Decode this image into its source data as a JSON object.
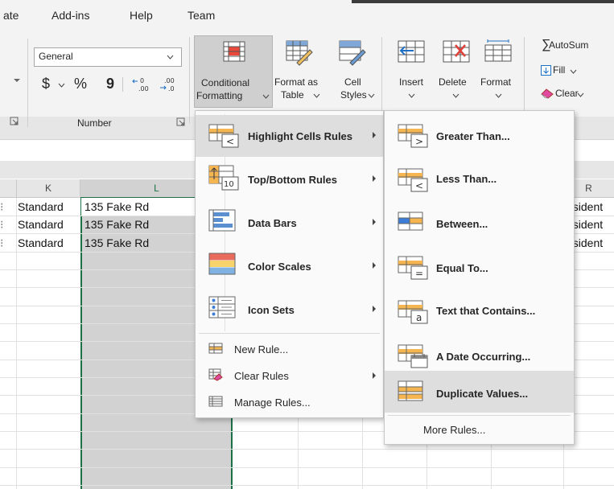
{
  "tabs": [
    "ate",
    "Add-ins",
    "Help",
    "Team"
  ],
  "ribbon": {
    "number_format": "General",
    "currency_symbol": "$",
    "percent_symbol": "%",
    "comma_symbol": "9",
    "number_group": "Number",
    "conditional_formatting": [
      "Conditional",
      "Formatting"
    ],
    "format_as_table": [
      "Format as",
      "Table"
    ],
    "cell_styles": [
      "Cell",
      "Styles"
    ],
    "insert": "Insert",
    "delete": "Delete",
    "format": "Format",
    "autosum": "AutoSum",
    "fill": "Fill",
    "clear": "Clear",
    "sigma_symbol": "∑"
  },
  "columns": {
    "k": "K",
    "l": "L",
    "r": "R"
  },
  "rows": [
    {
      "k": "Standard",
      "l": "135 Fake Rd",
      "r": "esident"
    },
    {
      "k": "Standard",
      "l": "135 Fake Rd",
      "r": "esident"
    },
    {
      "k": "Standard",
      "l": "135 Fake Rd",
      "r": "esident"
    }
  ],
  "cf_menu": {
    "highlight_cells_rules": "Highlight Cells Rules",
    "top_bottom_rules": "Top/Bottom Rules",
    "data_bars": "Data Bars",
    "color_scales": "Color Scales",
    "icon_sets": "Icon Sets",
    "new_rule": "New Rule...",
    "clear_rules": "Clear Rules",
    "manage_rules": "Manage Rules..."
  },
  "highlight_submenu": {
    "greater_than": "Greater Than...",
    "less_than": "Less Than...",
    "between": "Between...",
    "equal_to": "Equal To...",
    "text_contains": "Text that Contains...",
    "date_occurring": "A Date Occurring...",
    "duplicate_values": "Duplicate Values...",
    "more_rules": "More Rules..."
  },
  "icon_glyphs": {
    "lt": "<",
    "gt": ">",
    "eq": "=",
    "a": "a",
    "ten": "10"
  },
  "colors": {
    "accent_green": "#1e7145",
    "selection_gray": "#d2d2d2",
    "menu_hover": "#dedede"
  }
}
